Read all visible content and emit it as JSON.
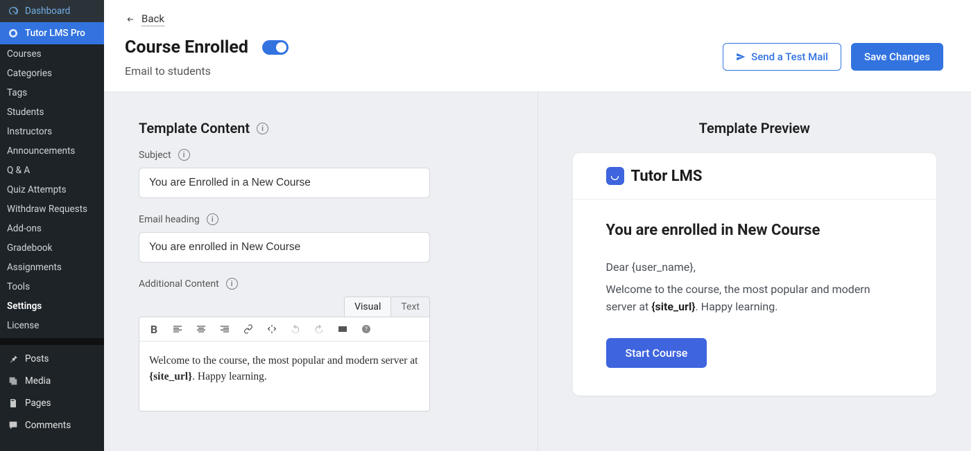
{
  "sidebar": {
    "dashboard": "Dashboard",
    "active": "Tutor LMS Pro",
    "subs": [
      "Courses",
      "Categories",
      "Tags",
      "Students",
      "Instructors",
      "Announcements",
      "Q & A",
      "Quiz Attempts",
      "Withdraw Requests",
      "Add-ons",
      "Gradebook",
      "Assignments",
      "Tools",
      "Settings",
      "License"
    ],
    "strongIndex": 13,
    "posts": "Posts",
    "media": "Media",
    "pages": "Pages",
    "comments": "Comments"
  },
  "header": {
    "back": "Back",
    "title": "Course Enrolled",
    "subtitle": "Email to students",
    "send_test": "Send a Test Mail",
    "save": "Save Changes"
  },
  "form": {
    "section_title": "Template Content",
    "subject_label": "Subject",
    "subject_value": "You are Enrolled in a New Course",
    "heading_label": "Email heading",
    "heading_value": "You are enrolled in New Course",
    "additional_label": "Additional Content",
    "tabs": {
      "visual": "Visual",
      "text": "Text"
    },
    "editor_html": "Welcome to the course, the most popular and modern server at <b>{site_url}</b>. Happy learning."
  },
  "preview": {
    "title": "Template Preview",
    "logo_text": "Tutor LMS",
    "heading": "You are enrolled in New Course",
    "greeting": "Dear {user_name},",
    "body_pre": "Welcome to the course, the most popular and modern server at ",
    "body_bold": "{site_url}",
    "body_post": ". Happy learning.",
    "cta": "Start Course"
  }
}
